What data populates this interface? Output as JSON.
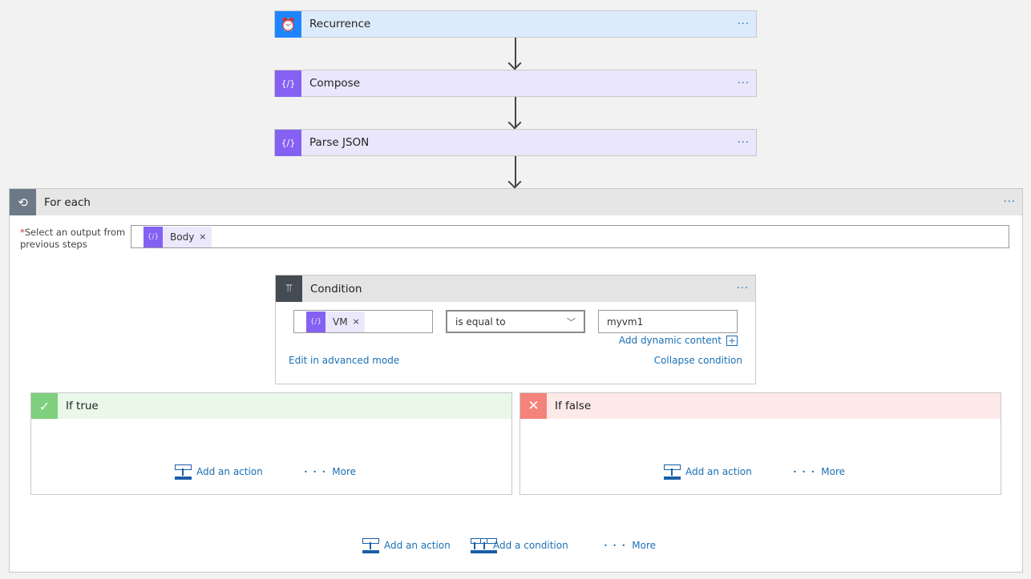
{
  "steps": [
    {
      "title": "Recurrence",
      "icon": "alarm-clock-icon",
      "color": "#1f85ff",
      "bg": "#dcebfb"
    },
    {
      "title": "Compose",
      "icon": "compose-braces-icon",
      "color": "#8461f2",
      "bg": "#eae6fb"
    },
    {
      "title": "Parse JSON",
      "icon": "compose-braces-icon",
      "color": "#8461f2",
      "bg": "#eae6fb"
    }
  ],
  "more_dots": "···",
  "foreach": {
    "title": "For each",
    "label_required": "*",
    "label": "Select an output from previous steps",
    "token": "Body",
    "token_remove": "×"
  },
  "condition": {
    "title": "Condition",
    "left_token": "VM",
    "token_remove": "×",
    "operator": "is equal to",
    "value": "myvm1",
    "add_dynamic": "Add dynamic content",
    "edit_advanced": "Edit in advanced mode",
    "collapse": "Collapse condition"
  },
  "if_true": {
    "title": "If true",
    "add_action": "Add an action",
    "more": "More"
  },
  "if_false": {
    "title": "If false",
    "add_action": "Add an action",
    "more": "More"
  },
  "bottom": {
    "add_action": "Add an action",
    "add_condition": "Add a condition",
    "more": "More"
  },
  "more_dots_small": "• • •"
}
